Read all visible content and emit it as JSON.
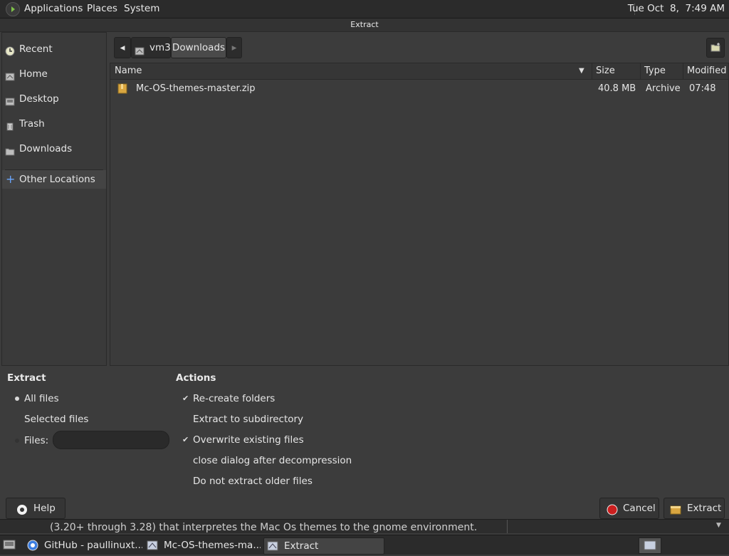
{
  "top_panel": {
    "menus": [
      "Applications",
      "Places",
      "System"
    ],
    "clock": "Tue Oct  8,  7:49 AM"
  },
  "window": {
    "title": "Extract"
  },
  "sidebar": {
    "items": [
      {
        "label": "Recent",
        "icon": "recent-icon"
      },
      {
        "label": "Home",
        "icon": "home-icon"
      },
      {
        "label": "Desktop",
        "icon": "desktop-icon"
      },
      {
        "label": "Trash",
        "icon": "trash-icon"
      },
      {
        "label": "Downloads",
        "icon": "folder-icon"
      }
    ],
    "other_locations": "Other Locations"
  },
  "pathbar": {
    "segments": [
      "vm3",
      "Downloads"
    ],
    "current": "Downloads"
  },
  "list": {
    "columns": [
      "Name",
      "Size",
      "Type",
      "Modified"
    ],
    "rows": [
      {
        "name": "Mc-OS-themes-master.zip",
        "size": "40.8 MB",
        "type": "Archive",
        "modified": "07:48"
      }
    ]
  },
  "extract": {
    "header": "Extract",
    "all_files": "All files",
    "selected_files": "Selected files",
    "files": "Files:",
    "files_value": "",
    "selected": "all_files"
  },
  "actions": {
    "header": "Actions",
    "items": [
      {
        "label": "Re-create folders",
        "checked": true
      },
      {
        "label": "Extract to subdirectory",
        "checked": false
      },
      {
        "label": "Overwrite existing files",
        "checked": true
      },
      {
        "label": "close dialog after decompression",
        "checked": false
      },
      {
        "label": "Do not extract older files",
        "checked": false
      }
    ]
  },
  "buttons": {
    "help": "Help",
    "cancel": "Cancel",
    "extract": "Extract"
  },
  "background": {
    "text": "(3.20+ through 3.28) that interpretes the Mac Os themes to the gnome environment."
  },
  "taskbar": {
    "items": [
      "GitHub - paullinuxt...",
      "Mc-OS-themes-ma...",
      "Extract"
    ]
  },
  "colors": {
    "accent": "#cc1f1f",
    "archive": "#d9a640"
  }
}
